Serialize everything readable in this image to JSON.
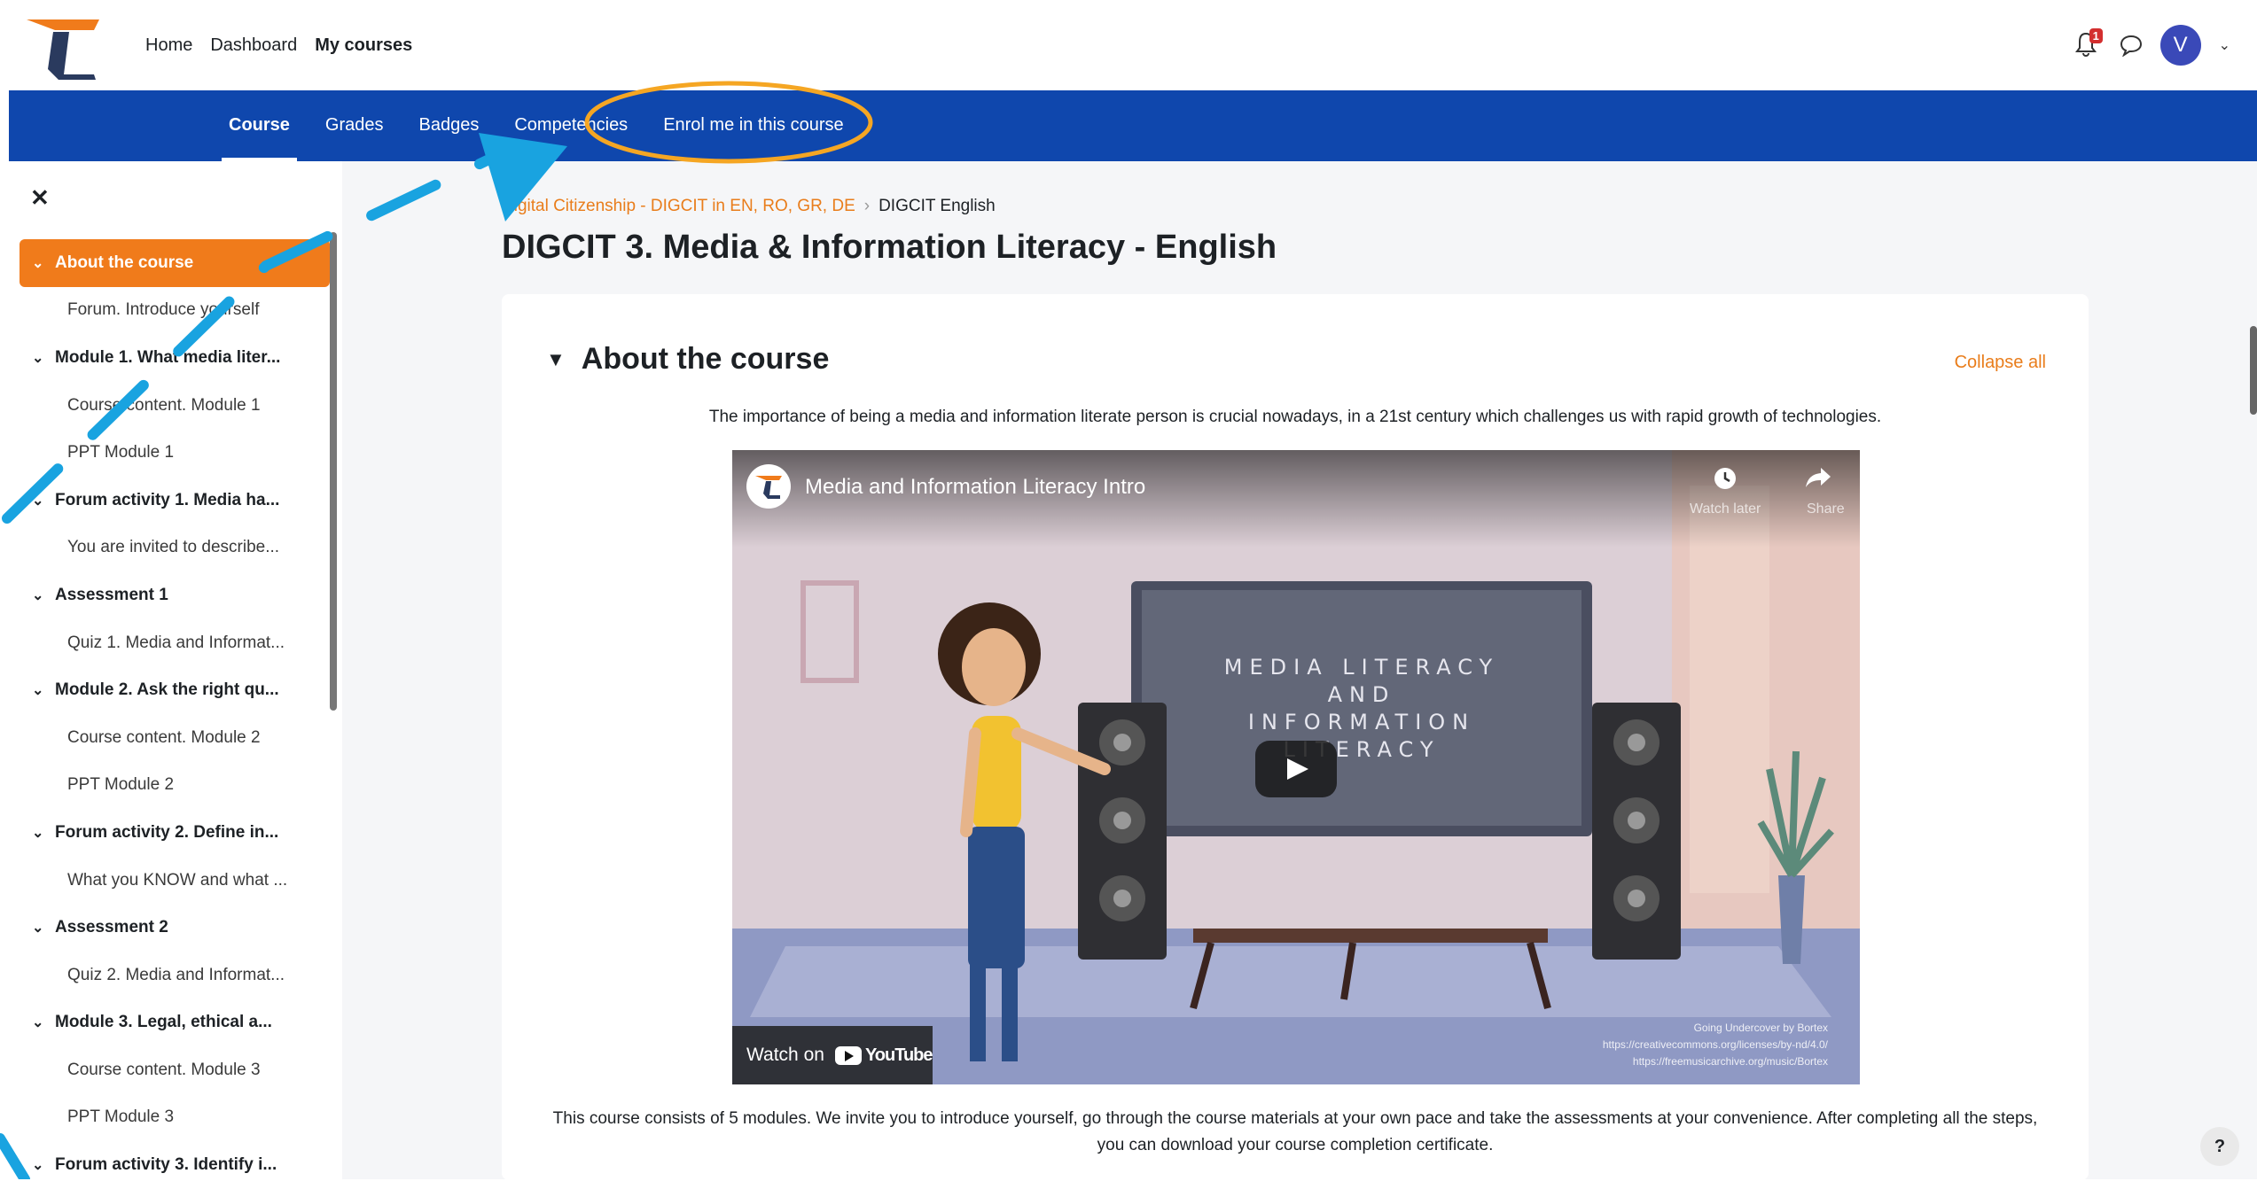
{
  "topnav": {
    "home": "Home",
    "dashboard": "Dashboard",
    "my_courses": "My courses"
  },
  "notifications": {
    "count": "1"
  },
  "user": {
    "initial": "V"
  },
  "course_nav": {
    "course": "Course",
    "grades": "Grades",
    "badges": "Badges",
    "competencies": "Competencies",
    "enrol": "Enrol me in this course"
  },
  "drawer": {
    "items": [
      {
        "label": "About the course",
        "kind": "section",
        "current": true
      },
      {
        "label": "Forum. Introduce yourself",
        "kind": "activity"
      },
      {
        "label": "Module 1. What media liter...",
        "kind": "section"
      },
      {
        "label": "Course content. Module 1",
        "kind": "activity"
      },
      {
        "label": "PPT Module 1",
        "kind": "activity"
      },
      {
        "label": "Forum activity 1. Media ha...",
        "kind": "section"
      },
      {
        "label": "You are invited to describe...",
        "kind": "activity"
      },
      {
        "label": "Assessment 1",
        "kind": "section"
      },
      {
        "label": "Quiz 1. Media and Informat...",
        "kind": "activity"
      },
      {
        "label": "Module 2. Ask the right qu...",
        "kind": "section"
      },
      {
        "label": "Course content. Module 2",
        "kind": "activity"
      },
      {
        "label": "PPT Module 2",
        "kind": "activity"
      },
      {
        "label": "Forum activity 2. Define in...",
        "kind": "section"
      },
      {
        "label": "What you KNOW and what ...",
        "kind": "activity"
      },
      {
        "label": "Assessment 2",
        "kind": "section"
      },
      {
        "label": "Quiz 2. Media and Informat...",
        "kind": "activity"
      },
      {
        "label": "Module 3. Legal, ethical a...",
        "kind": "section"
      },
      {
        "label": "Course content. Module 3",
        "kind": "activity"
      },
      {
        "label": "PPT Module 3",
        "kind": "activity"
      },
      {
        "label": "Forum activity 3. Identify i...",
        "kind": "section"
      }
    ]
  },
  "breadcrumb": {
    "parent": "Digital Citizenship - DIGCIT in EN, RO, GR, DE",
    "current": "DIGCIT English"
  },
  "page_title": "DIGCIT 3. Media & Information Literacy - English",
  "section": {
    "title": "About the course",
    "collapse_all": "Collapse all",
    "summary": "The importance of being a media and information literate person is crucial nowadays, in a 21st century which challenges us with rapid growth of technologies.",
    "description": "This course consists of 5 modules. We invite you to introduce yourself, go through the course materials at your own pace and take the assessments at your convenience. After completing all the steps, you can download your course completion certificate."
  },
  "video": {
    "title": "Media and Information Literacy Intro",
    "watch_later": "Watch later",
    "share": "Share",
    "screen_lines": [
      "MEDIA LITERACY",
      "AND",
      "INFORMATION",
      "LITERACY"
    ],
    "watch_on": "Watch on",
    "youtube": "YouTube",
    "credits": [
      "Going Undercover by Bortex",
      "https://creativecommons.org/licenses/by-nd/4.0/",
      "https://freemusicarchive.org/music/Bortex"
    ]
  },
  "help": "?",
  "colors": {
    "brand_blue": "#0f47ad",
    "accent_orange": "#f07b1b",
    "annotation_blue": "#19a3e0",
    "annotation_orange": "#f5a623"
  }
}
